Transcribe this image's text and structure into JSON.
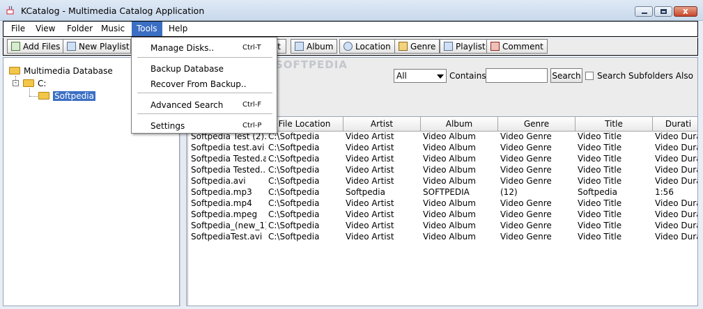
{
  "window": {
    "title": "KCatalog - Multimedia Catalog Application",
    "close_symbol": "x"
  },
  "menubar": {
    "items": [
      {
        "label": "File"
      },
      {
        "label": "View"
      },
      {
        "label": "Folder"
      },
      {
        "label": "Music"
      },
      {
        "label": "Tools"
      },
      {
        "label": "Help"
      }
    ],
    "active": "Tools"
  },
  "toolbar": {
    "buttons": [
      {
        "label": "Add Files",
        "icon": "add-files-icon"
      },
      {
        "label": "New Playlist",
        "icon": "new-playlist-icon"
      },
      {
        "label": "st",
        "icon": "list-icon"
      },
      {
        "label": "Album",
        "icon": "album-icon"
      },
      {
        "label": "Location",
        "icon": "location-icon"
      },
      {
        "label": "Genre",
        "icon": "genre-icon"
      },
      {
        "label": "Playlist",
        "icon": "playlist-icon"
      },
      {
        "label": "Comment",
        "icon": "comment-icon"
      }
    ]
  },
  "tools_menu": {
    "items": [
      {
        "label": "Manage Disks..",
        "shortcut": "Ctrl-T"
      },
      {
        "label": "Backup Database",
        "shortcut": ""
      },
      {
        "label": "Recover From Backup..",
        "shortcut": ""
      },
      {
        "label": "Advanced Search",
        "shortcut": "Ctrl-F"
      },
      {
        "label": "Settings",
        "shortcut": "Ctrl-P"
      }
    ]
  },
  "tree": {
    "root": "Multimedia Database",
    "drive": "C:",
    "folder": "Softpedia",
    "expander": "-"
  },
  "search": {
    "filter_value": "All",
    "contains_label": "Contains",
    "input_value": "",
    "button_label": "Search",
    "subfolders_label": "Search Subfolders Also",
    "subfolders_checked": false
  },
  "watermark": "SOFTPEDIA",
  "table": {
    "columns": [
      "",
      "File Location",
      "Artist",
      "Album",
      "Genre",
      "Title",
      "Durati"
    ],
    "rows": [
      [
        "Softpedia Test (2)....",
        "C:\\Softpedia",
        "Video Artist",
        "Video Album",
        "Video Genre",
        "Video Title",
        "Video Durat"
      ],
      [
        "Softpedia test.avi",
        "C:\\Softpedia",
        "Video Artist",
        "Video Album",
        "Video Genre",
        "Video Title",
        "Video Durat"
      ],
      [
        "Softpedia Tested.avi",
        "C:\\Softpedia",
        "Video Artist",
        "Video Album",
        "Video Genre",
        "Video Title",
        "Video Durat"
      ],
      [
        "Softpedia Tested....",
        "C:\\Softpedia",
        "Video Artist",
        "Video Album",
        "Video Genre",
        "Video Title",
        "Video Durat"
      ],
      [
        "Softpedia.avi",
        "C:\\Softpedia",
        "Video Artist",
        "Video Album",
        "Video Genre",
        "Video Title",
        "Video Durat"
      ],
      [
        "Softpedia.mp3",
        "C:\\Softpedia",
        "Softpedia",
        "SOFTPEDIA",
        "(12)",
        "Softpedia",
        "1:56"
      ],
      [
        "Softpedia.mp4",
        "C:\\Softpedia",
        "Video Artist",
        "Video Album",
        "Video Genre",
        "Video Title",
        "Video Durat"
      ],
      [
        "Softpedia.mpeg",
        "C:\\Softpedia",
        "Video Artist",
        "Video Album",
        "Video Genre",
        "Video Title",
        "Video Durat"
      ],
      [
        "Softpedia_(new_1)....",
        "C:\\Softpedia",
        "Video Artist",
        "Video Album",
        "Video Genre",
        "Video Title",
        "Video Durat"
      ],
      [
        "SoftpediaTest.avi",
        "C:\\Softpedia",
        "Video Artist",
        "Video Album",
        "Video Genre",
        "Video Title",
        "Video Durat"
      ]
    ]
  }
}
